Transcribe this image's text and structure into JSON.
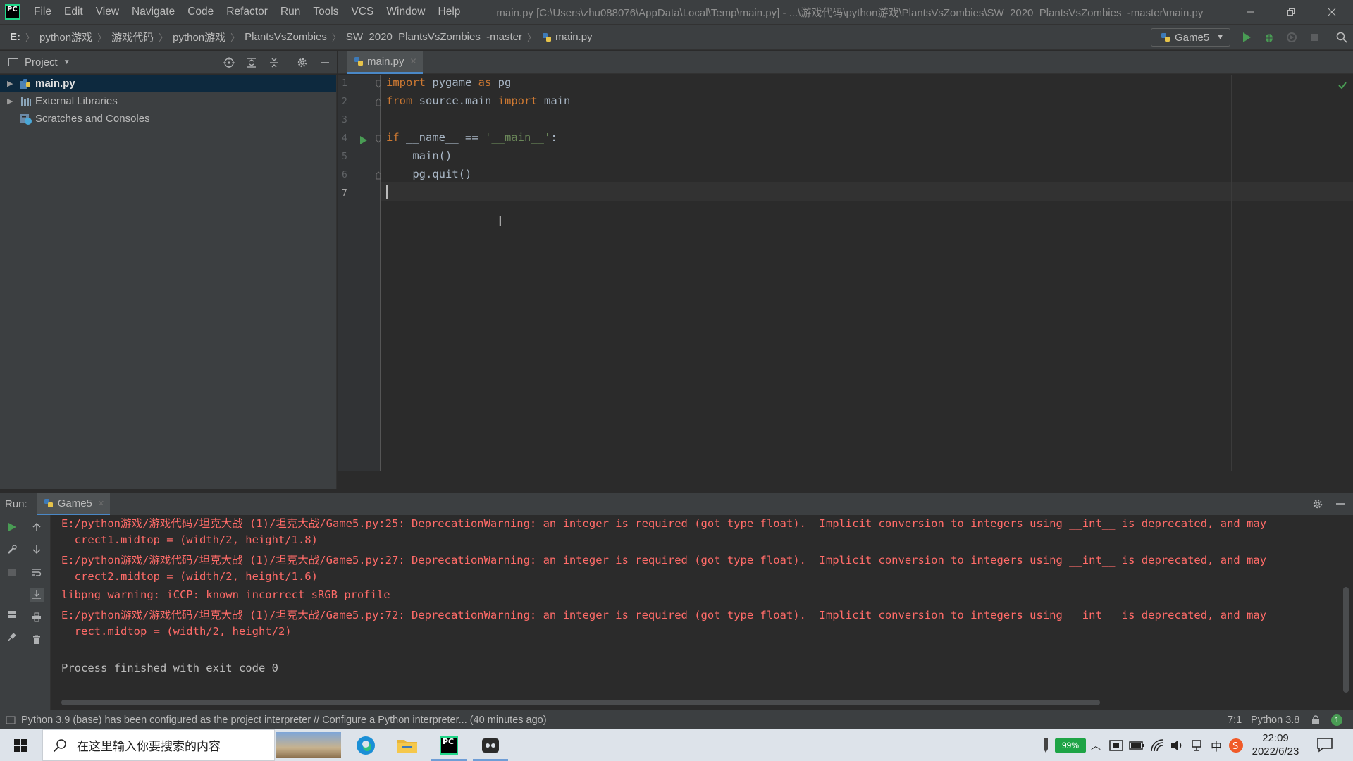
{
  "titlebar": {
    "logo_text": "PC",
    "menu": [
      "File",
      "Edit",
      "View",
      "Navigate",
      "Code",
      "Refactor",
      "Run",
      "Tools",
      "VCS",
      "Window",
      "Help"
    ],
    "window_title": "main.py [C:\\Users\\zhu088076\\AppData\\Local\\Temp\\main.py] - ...\\游戏代码\\python游戏\\PlantsVsZombies\\SW_2020_PlantsVsZombies_-master\\main.py"
  },
  "navbar": {
    "breadcrumbs": [
      "E:",
      "python游戏",
      "游戏代码",
      "python游戏",
      "PlantsVsZombies",
      "SW_2020_PlantsVsZombies_-master",
      "main.py"
    ],
    "run_config": "Game5"
  },
  "project": {
    "title": "Project",
    "items": [
      {
        "label": "main.py",
        "selected": true
      },
      {
        "label": "External Libraries",
        "selected": false
      },
      {
        "label": "Scratches and Consoles",
        "selected": false
      }
    ]
  },
  "editor": {
    "tab_label": "main.py",
    "line_numbers": [
      "1",
      "2",
      "3",
      "4",
      "5",
      "6",
      "7"
    ]
  },
  "code": {
    "l1_kw1": "import",
    "l1_mid": " pygame ",
    "l1_kw2": "as",
    "l1_end": " pg",
    "l2_kw1": "from",
    "l2_mid": " source.main ",
    "l2_kw2": "import",
    "l2_end": " main",
    "l4_kw": "if",
    "l4_mid": " __name__ == ",
    "l4_str": "'__main__'",
    "l4_end": ":",
    "l5": "    main()",
    "l6": "    pg.quit()"
  },
  "run": {
    "label": "Run:",
    "tab_label": "Game5",
    "output": [
      {
        "text": "E:/python游戏/游戏代码/坦克大战 (1)/坦克大战/Game5.py:25: DeprecationWarning: an integer is required (got type float).  Implicit conversion to integers using __int__ is deprecated, and may",
        "kind": "err"
      },
      {
        "text": "  crect1.midtop = (width/2, height/1.8)",
        "kind": "err"
      },
      {
        "text": "E:/python游戏/游戏代码/坦克大战 (1)/坦克大战/Game5.py:27: DeprecationWarning: an integer is required (got type float).  Implicit conversion to integers using __int__ is deprecated, and may",
        "kind": "err"
      },
      {
        "text": "  crect2.midtop = (width/2, height/1.6)",
        "kind": "err"
      },
      {
        "text": "libpng warning: iCCP: known incorrect sRGB profile",
        "kind": "err"
      },
      {
        "text": "E:/python游戏/游戏代码/坦克大战 (1)/坦克大战/Game5.py:72: DeprecationWarning: an integer is required (got type float).  Implicit conversion to integers using __int__ is deprecated, and may",
        "kind": "err"
      },
      {
        "text": "  rect.midtop = (width/2, height/2)",
        "kind": "err"
      },
      {
        "text": "",
        "kind": "plain"
      },
      {
        "text": "Process finished with exit code 0",
        "kind": "plain"
      }
    ]
  },
  "statusbar": {
    "message": "Python 3.9 (base) has been configured as the project interpreter // Configure a Python interpreter... (40 minutes ago)",
    "position": "7:1",
    "interpreter": "Python 3.8",
    "event_count": "1"
  },
  "taskbar": {
    "search_placeholder": "在这里输入你要搜索的内容",
    "battery": "99%",
    "ime": "中",
    "time": "22:09",
    "date": "2022/6/23",
    "pycharm_icon_text": "PC"
  },
  "colors": {
    "accent": "#4a88c7",
    "error": "#ff6b68",
    "keyword": "#cc7832",
    "string": "#6a8759",
    "run_green": "#499c54"
  }
}
